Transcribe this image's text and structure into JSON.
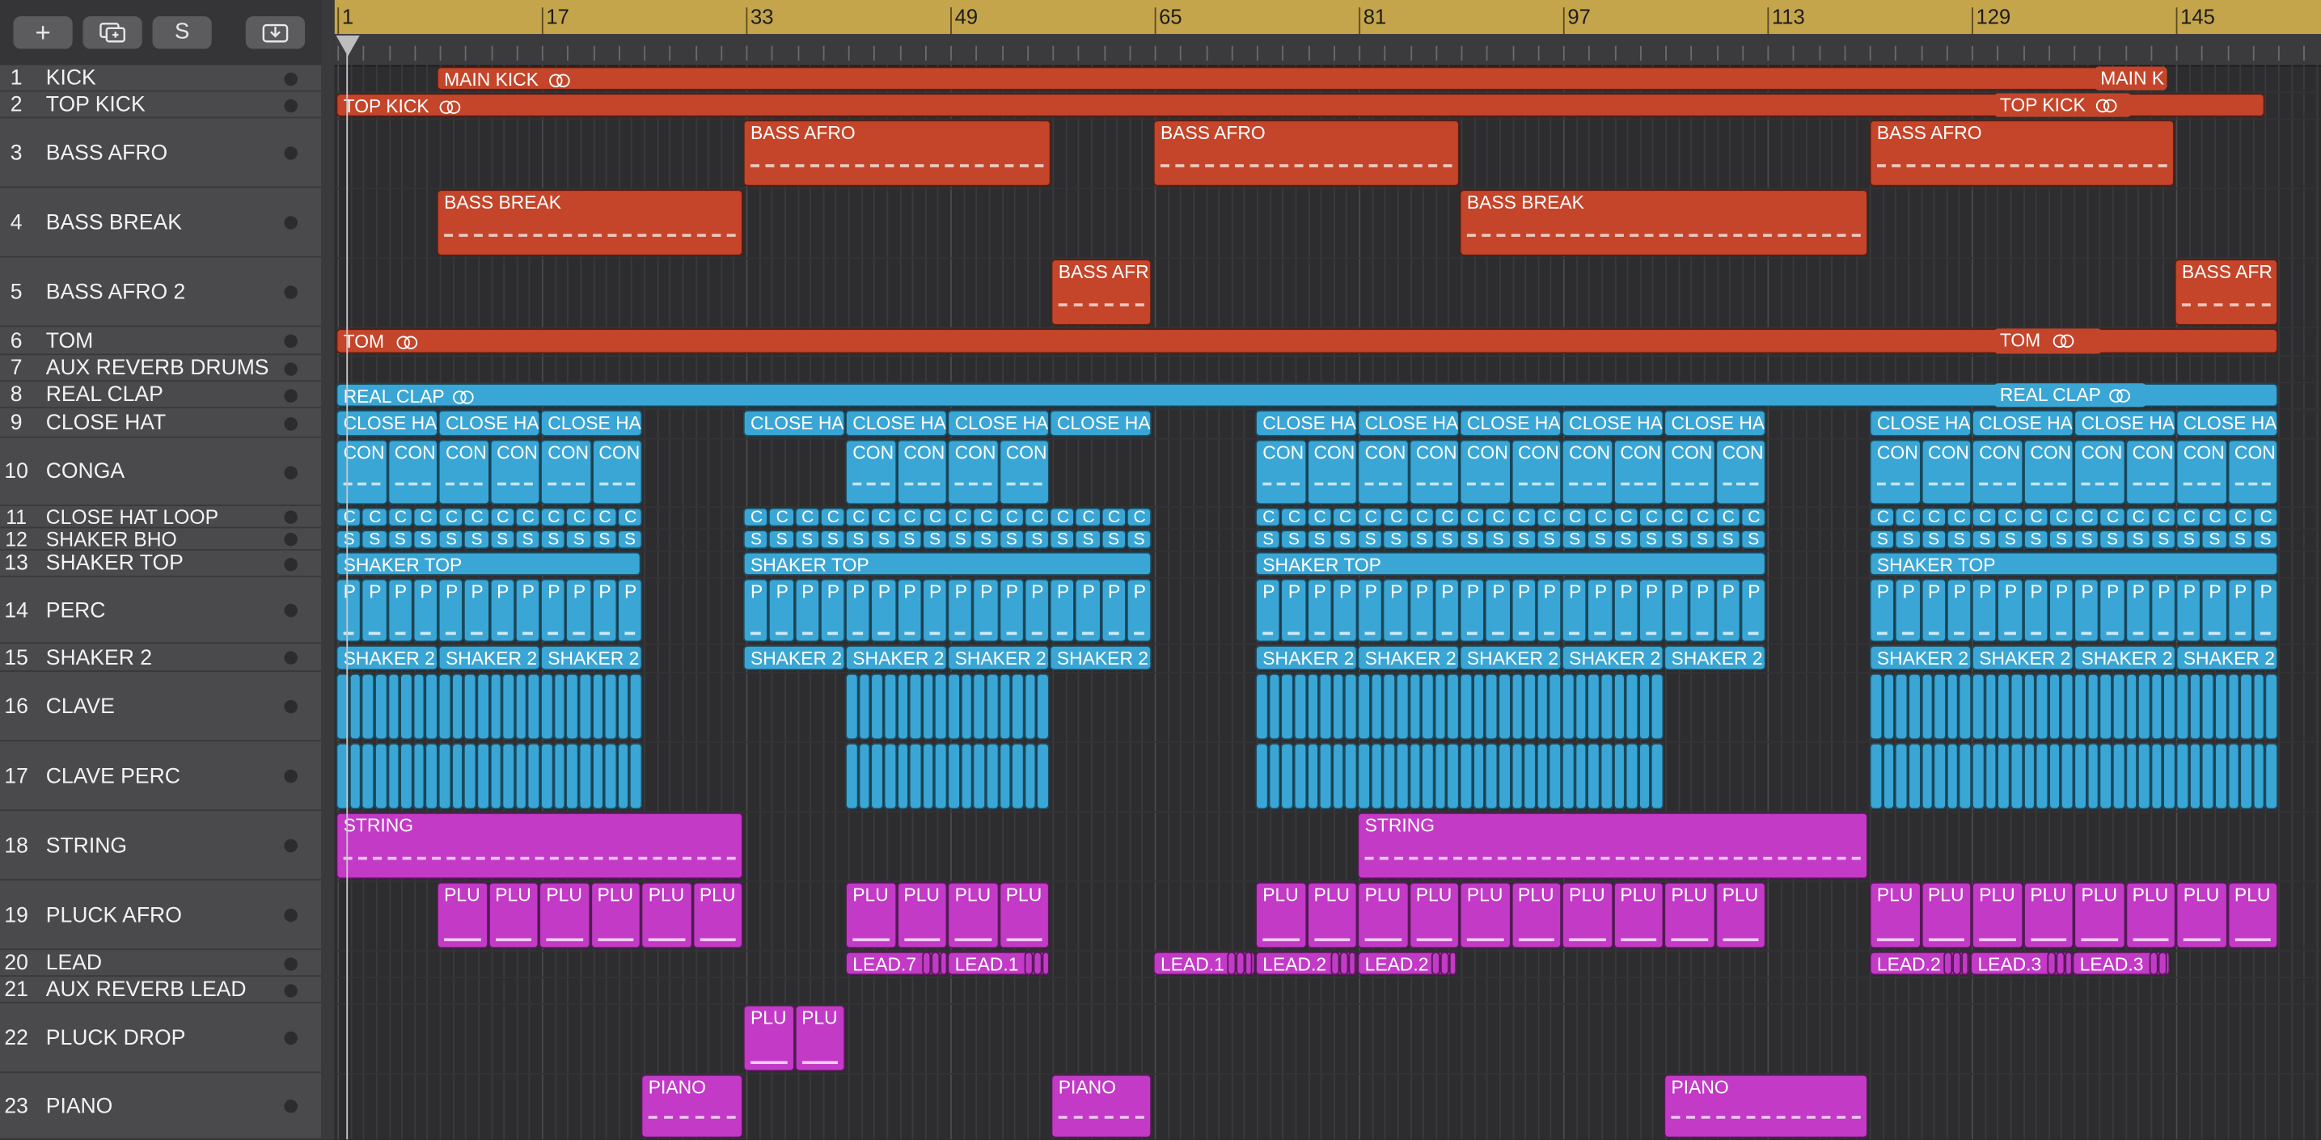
{
  "toolbar": {
    "add_track_icon": "plus-icon",
    "duplicate_icon": "duplicate-track-icon",
    "s_label": "S",
    "download_icon": "download-icon"
  },
  "ruler": {
    "bars": [
      "1",
      "17",
      "33",
      "49",
      "65",
      "81",
      "97",
      "113",
      "129",
      "145"
    ]
  },
  "tracks": [
    {
      "num": "1",
      "name": "KICK"
    },
    {
      "num": "2",
      "name": "TOP KICK"
    },
    {
      "num": "3",
      "name": "BASS AFRO"
    },
    {
      "num": "4",
      "name": "BASS BREAK"
    },
    {
      "num": "5",
      "name": "BASS AFRO 2"
    },
    {
      "num": "6",
      "name": "TOM"
    },
    {
      "num": "7",
      "name": "AUX REVERB DRUMS"
    },
    {
      "num": "8",
      "name": "REAL CLAP"
    },
    {
      "num": "9",
      "name": "CLOSE HAT"
    },
    {
      "num": "10",
      "name": "CONGA"
    },
    {
      "num": "11",
      "name": "CLOSE HAT LOOP"
    },
    {
      "num": "12",
      "name": "SHAKER BHO"
    },
    {
      "num": "13",
      "name": "SHAKER TOP"
    },
    {
      "num": "14",
      "name": "PERC"
    },
    {
      "num": "15",
      "name": "SHAKER 2"
    },
    {
      "num": "16",
      "name": "CLAVE"
    },
    {
      "num": "17",
      "name": "CLAVE PERC"
    },
    {
      "num": "18",
      "name": "STRING"
    },
    {
      "num": "19",
      "name": "PLUCK AFRO"
    },
    {
      "num": "20",
      "name": "LEAD"
    },
    {
      "num": "21",
      "name": "AUX REVERB LEAD"
    },
    {
      "num": "22",
      "name": "PLUCK DROP"
    },
    {
      "num": "23",
      "name": "PIANO"
    }
  ],
  "region_labels": {
    "main_kick": "MAIN KICK",
    "main_kick_end": "MAIN K",
    "top_kick": "TOP KICK",
    "bass_afro": "BASS AFRO",
    "bass_break": "BASS BREAK",
    "bass_afr": "BASS AFR",
    "tom": "TOM",
    "real_clap": "REAL CLAP",
    "close_ha": "CLOSE HA",
    "con": "CON",
    "c": "C",
    "s": "S",
    "shaker_top": "SHAKER TOP",
    "p": "P",
    "shaker_2_dot": "SHAKER 2.",
    "shaker_2": "SHAKER 2",
    "string": "STRING",
    "plu": "PLU",
    "lead_7": "LEAD.7",
    "lead_1": "LEAD.1",
    "lead_2": "LEAD.2",
    "lead_3": "LEAD.3",
    "piano": "PIANO"
  },
  "colors": {
    "bass": "#c5452a",
    "drums_blue": "#3aa6d5",
    "synth_magenta": "#c23ac6",
    "ruler": "#c5a54b"
  }
}
